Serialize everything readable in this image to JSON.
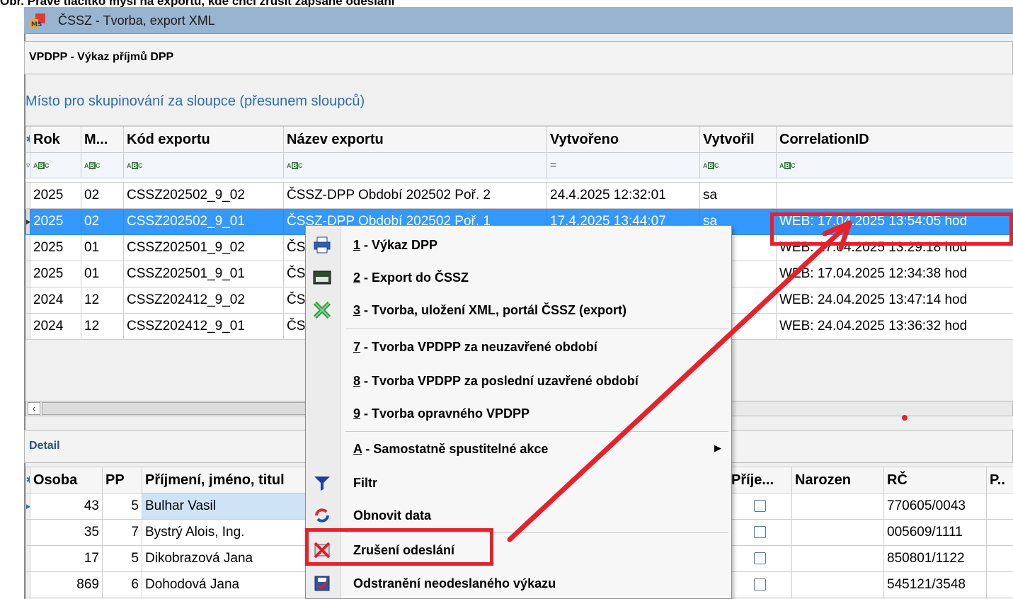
{
  "caption": "Obr. Pravé tlačítko myši na exportu, kde chci zrušit zapsané odeslání",
  "window": {
    "title": "ČSSZ - Tvorba, export XML"
  },
  "master": {
    "section_title": "VPDPP - Výkaz příjmů DPP",
    "group_hint": "Místo pro skupinování za sloupce (přesunem sloupců)",
    "columns": [
      "Rok",
      "M...",
      "Kód exportu",
      "Název exportu",
      "Vytvořeno",
      "Vytvořil",
      "CorrelationID"
    ],
    "filter_labels": {
      "text": "ABC",
      "equals": "="
    },
    "rows": [
      {
        "rok": "2025",
        "m": "02",
        "kod": "CSSZ202502_9_02",
        "nazev": "ČSSZ-DPP Období 202502 Poř. 2",
        "vytvoreno": "24.4.2025 12:32:01",
        "vytvoril": "sa",
        "corr": ""
      },
      {
        "rok": "2025",
        "m": "02",
        "kod": "CSSZ202502_9_01",
        "nazev": "ČSSZ-DPP Období 202502 Poř. 1",
        "vytvoreno": "17.4.2025 13:44:07",
        "vytvoril": "sa",
        "corr": "WEB: 17.04.2025 13:54:05 hod"
      },
      {
        "rok": "2025",
        "m": "01",
        "kod": "CSSZ202501_9_02",
        "nazev": "ČS",
        "vytvoreno": "",
        "vytvoril": "",
        "corr": "WEB: 17.04.2025 13:29:18 hod"
      },
      {
        "rok": "2025",
        "m": "01",
        "kod": "CSSZ202501_9_01",
        "nazev": "ČS",
        "vytvoreno": "",
        "vytvoril": "",
        "corr": "WEB: 17.04.2025 12:34:38 hod"
      },
      {
        "rok": "2024",
        "m": "12",
        "kod": "CSSZ202412_9_02",
        "nazev": "ČS",
        "vytvoreno": "",
        "vytvoril": "",
        "corr": "WEB: 24.04.2025 13:47:14 hod"
      },
      {
        "rok": "2024",
        "m": "12",
        "kod": "CSSZ202412_9_01",
        "nazev": "ČS",
        "vytvoreno": "",
        "vytvoril": "",
        "corr": "WEB: 24.04.2025 13:36:32 hod"
      }
    ]
  },
  "detail": {
    "section_title": "Detail",
    "columns": [
      "Osoba",
      "PP",
      "Příjmení, jméno, titul",
      "Příje...",
      "Narozen",
      "RČ",
      "P.."
    ],
    "rows": [
      {
        "osoba": "43",
        "pp": "5",
        "jmeno": "Bulhar Vasil",
        "rc": "770605/0043"
      },
      {
        "osoba": "35",
        "pp": "7",
        "jmeno": "Bystrý Alois, Ing.",
        "rc": "005609/1111"
      },
      {
        "osoba": "17",
        "pp": "5",
        "jmeno": "Dikobrazová Jana",
        "rc": "850801/1122"
      },
      {
        "osoba": "869",
        "pp": "6",
        "jmeno": "Dohodová Jana",
        "rc": "545121/3548"
      }
    ]
  },
  "context_menu": {
    "items": [
      {
        "key": "1",
        "label": " - Výkaz DPP",
        "icon": "printer-icon"
      },
      {
        "key": "2",
        "label": " - Export do ČSSZ",
        "icon": "export-icon"
      },
      {
        "key": "3",
        "label": " - Tvorba, uložení XML, portál ČSSZ (export)",
        "icon": "xml-icon"
      },
      {
        "key": "7",
        "label": " - Tvorba VPDPP za neuzavřené období"
      },
      {
        "key": "8",
        "label": " - Tvorba VPDPP za poslední uzavřené období"
      },
      {
        "key": "9",
        "label": " - Tvorba opravného VPDPP"
      },
      {
        "key": "A",
        "label": " - Samostatně spustitelné akce",
        "submenu_arrow": "▶"
      },
      {
        "key": "",
        "label": "Filtr",
        "icon": "filter-icon"
      },
      {
        "key": "",
        "label": "Obnovit data",
        "icon": "refresh-icon"
      },
      {
        "key": "",
        "label": "Zrušení odeslání",
        "icon": "cancel-send-icon"
      },
      {
        "key": "",
        "label": "Odstranění neodeslaného výkazu",
        "icon": "delete-report-icon"
      }
    ]
  },
  "colors": {
    "selection": "#3399ff",
    "annotation_red": "#e8202a",
    "link_blue": "#2b6fb0"
  }
}
